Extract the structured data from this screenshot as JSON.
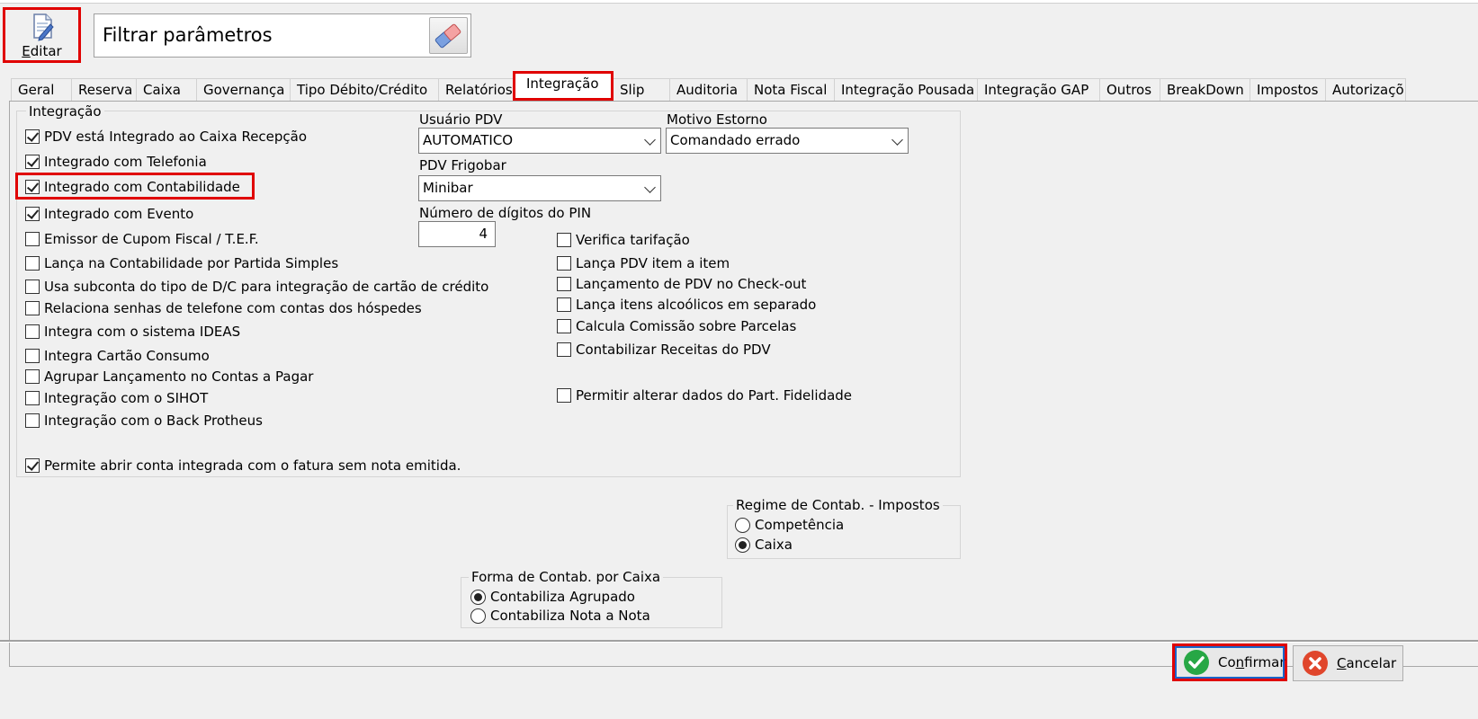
{
  "toolbar": {
    "edit_label_underlined": "E",
    "edit_label_rest": "ditar",
    "filter_text": "Filtrar parâmetros",
    "icons": {
      "edit": "edit-document-icon",
      "filter_clear": "eraser-icon"
    }
  },
  "tabs": [
    {
      "label": "Geral"
    },
    {
      "label": "Reserva"
    },
    {
      "label": "Caixa"
    },
    {
      "label": "Governança"
    },
    {
      "label": "Tipo Débito/Crédito"
    },
    {
      "label": "Relatórios"
    },
    {
      "label": "Integração",
      "active": true
    },
    {
      "label": "Slip"
    },
    {
      "label": "Auditoria"
    },
    {
      "label": "Nota Fiscal"
    },
    {
      "label": "Integração Pousada"
    },
    {
      "label": "Integração GAP"
    },
    {
      "label": "Outros"
    },
    {
      "label": "BreakDown"
    },
    {
      "label": "Impostos"
    },
    {
      "label": "Autorizaçõ"
    }
  ],
  "integracao_group": {
    "title": "Integração",
    "left_checks": [
      {
        "label": "PDV está Integrado ao Caixa Recepção",
        "checked": true
      },
      {
        "label": "Integrado com Telefonia",
        "checked": true
      },
      {
        "label": "Integrado com Contabilidade",
        "checked": true
      },
      {
        "label": "Integrado com Evento",
        "checked": true
      },
      {
        "label": "Emissor de Cupom Fiscal / T.E.F.",
        "checked": false
      },
      {
        "label": "Lança na Contabilidade por Partida Simples",
        "checked": false
      },
      {
        "label": "Usa subconta do tipo de D/C para integração de cartão de crédito",
        "checked": false
      },
      {
        "label": "Relaciona senhas de telefone com contas dos hóspedes",
        "checked": false
      },
      {
        "label": "Integra com o sistema IDEAS",
        "checked": false
      },
      {
        "label": "Integra Cartão Consumo",
        "checked": false
      },
      {
        "label": "Agrupar Lançamento no Contas a Pagar",
        "checked": false
      },
      {
        "label": "Integração com o SIHOT",
        "checked": false
      },
      {
        "label": "Integração com o Back Protheus",
        "checked": false
      }
    ],
    "permite": {
      "label": "Permite abrir conta integrada com o fatura sem nota emitida.",
      "checked": true
    },
    "usuario_pdv": {
      "label": "Usuário PDV",
      "value": "AUTOMATICO"
    },
    "motivo_estorno": {
      "label": "Motivo Estorno",
      "value": "Comandado errado"
    },
    "pdv_frigobar": {
      "label": "PDV Frigobar",
      "value": "Minibar"
    },
    "pin": {
      "label": "Número de dígitos do PIN",
      "value": "4"
    },
    "right_checks": [
      {
        "label": "Verifica tarifação",
        "checked": false
      },
      {
        "label": "Lança PDV item a item",
        "checked": false
      },
      {
        "label": "Lançamento de PDV no Check-out",
        "checked": false
      },
      {
        "label": "Lança itens alcoólicos em separado",
        "checked": false
      },
      {
        "label": "Calcula Comissão sobre Parcelas",
        "checked": false
      },
      {
        "label": "Contabilizar Receitas do PDV",
        "checked": false
      }
    ],
    "fidelidade": {
      "label": "Permitir alterar dados do Part. Fidelidade",
      "checked": false
    }
  },
  "regime": {
    "title": "Regime de Contab. - Impostos",
    "options": [
      {
        "label": "Competência",
        "selected": false
      },
      {
        "label": "Caixa",
        "selected": true
      }
    ]
  },
  "forma": {
    "title": "Forma de Contab. por Caixa",
    "options": [
      {
        "label": "Contabiliza Agrupado",
        "selected": true
      },
      {
        "label": "Contabiliza Nota a Nota",
        "selected": false
      }
    ]
  },
  "buttons": {
    "confirm_pre": "Co",
    "confirm_ul": "n",
    "confirm_post": "firmar",
    "cancel_ul": "C",
    "cancel_post": "ancelar",
    "confirm_color": "#27a745",
    "cancel_color": "#e0462c"
  }
}
